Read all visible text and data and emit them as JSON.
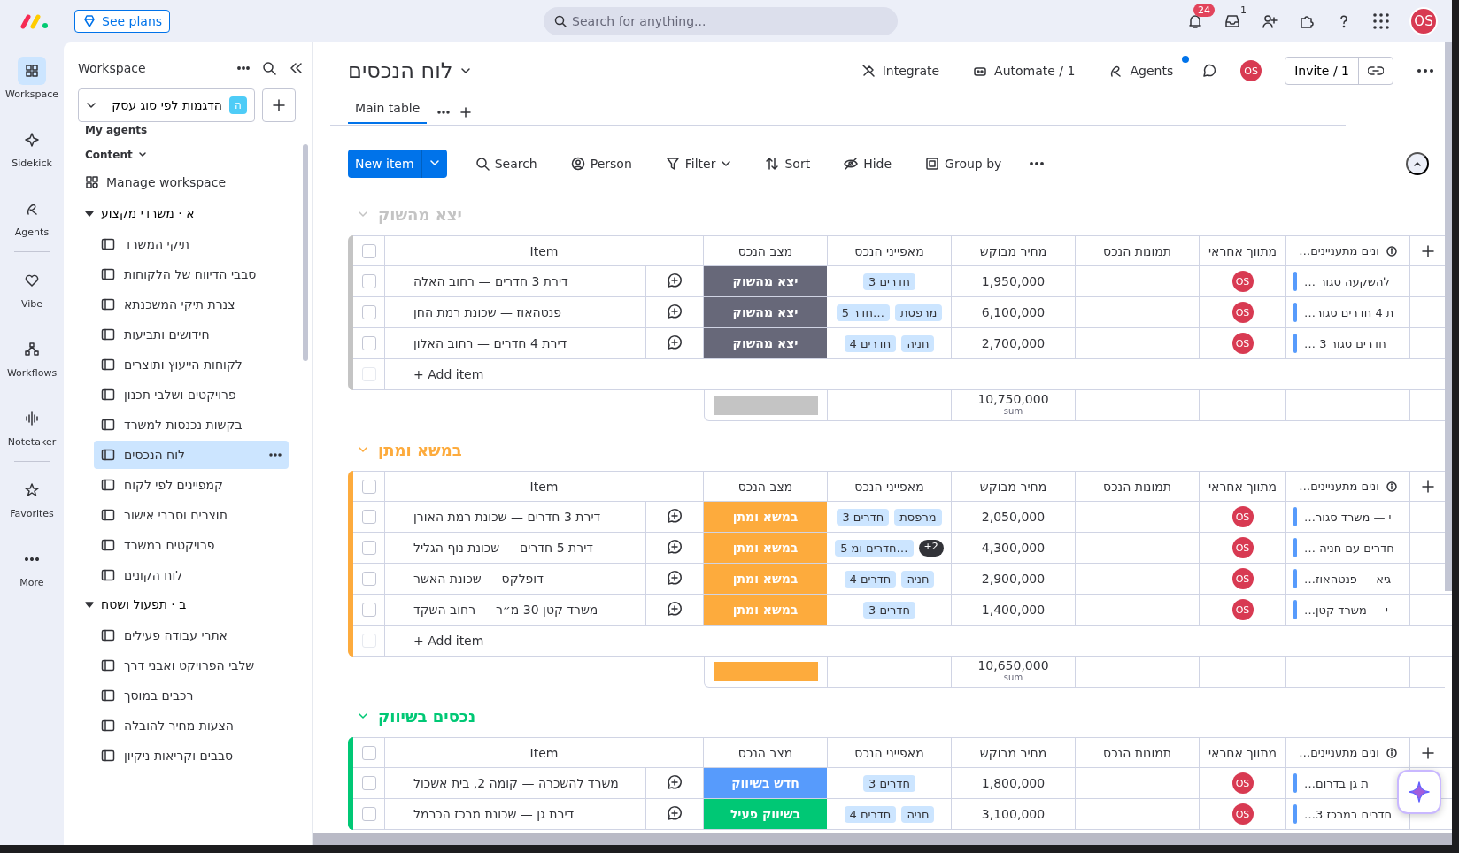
{
  "topbar": {
    "plans_button": "See plans",
    "search": {
      "placeholder": "Search for anything..."
    },
    "notifications_badge": "24",
    "inbox_count": "1",
    "avatar": "OS"
  },
  "rail": [
    {
      "label": "Workspace",
      "selected": true
    },
    {
      "label": "Sidekick",
      "selected": false
    },
    {
      "label": "Agents",
      "selected": false
    },
    {
      "label": "Vibe",
      "selected": false
    },
    {
      "label": "Workflows",
      "selected": false
    },
    {
      "label": "Notetaker",
      "selected": false
    },
    {
      "label": "Favorites",
      "selected": false
    },
    {
      "label": "More",
      "selected": false
    }
  ],
  "sidebar": {
    "title": "Workspace",
    "workspace": {
      "badge": "ה",
      "name": "הדגמות לפי סוג עסק"
    },
    "my_agents": "My agents",
    "content": "Content",
    "manage": "Manage workspace",
    "folders": [
      {
        "label": "א · משרדי מקצוע",
        "expanded": true,
        "children": [
          {
            "label": "תיקי המשרד",
            "selected": false
          },
          {
            "label": "סבבי הדיווח של הלקוחות",
            "selected": false
          },
          {
            "label": "צנרת תיקי המשכנתא",
            "selected": false
          },
          {
            "label": "חידושים ותביעות",
            "selected": false
          },
          {
            "label": "לקוחות הייעוץ ותוצרים",
            "selected": false
          },
          {
            "label": "פרויקטים ושלבי תכנון",
            "selected": false
          },
          {
            "label": "בקשות נכנסות למשרד",
            "selected": false
          },
          {
            "label": "לוח הנכסים",
            "selected": true
          },
          {
            "label": "קמפיינים לפי לקוח",
            "selected": false
          },
          {
            "label": "תוצרים וסבבי אישור",
            "selected": false
          },
          {
            "label": "פרויקטים במשרד",
            "selected": false
          },
          {
            "label": "לוח הקונים",
            "selected": false
          }
        ]
      },
      {
        "label": "ב · תפעול ושטח",
        "expanded": true,
        "children": [
          {
            "label": "אתרי עבודה פעילים",
            "selected": false
          },
          {
            "label": "שלבי הפרויקט ואבני דרך",
            "selected": false
          },
          {
            "label": "רכבים במוסך",
            "selected": false
          },
          {
            "label": "הצעות מחיר להובלה",
            "selected": false
          },
          {
            "label": "סבבים וקריאות ניקיון",
            "selected": false
          }
        ]
      }
    ]
  },
  "board": {
    "title": "לוח הנכסים",
    "actions": [
      "Agents",
      "Automate / 1",
      "Integrate"
    ],
    "avatar": "OS",
    "invite": "Invite / 1",
    "tabs": [
      {
        "label": "Main table",
        "selected": true
      }
    ],
    "toolbar": {
      "new_item": "New item",
      "items": [
        "Group by",
        "Hide",
        "Sort",
        "Filter",
        "Person",
        "Search"
      ]
    },
    "groups": [
      {
        "title": "יצא מהשוק",
        "color": "#c4c4c4",
        "expanded": true,
        "select_all_checked": false,
        "columns": [
          "…ונים מתעניינים",
          "מתווך אחראי",
          "תמונות הנכס",
          "מחיר מבוקש",
          "מאפייני הנכס",
          "מצב הנכס",
          "Item"
        ],
        "add_item": {
          "label": "+ Add item",
          "checked": false
        },
        "summary": {
          "sum": "10,750,000",
          "label": "sum"
        },
        "rows": [
          {
            "checked": false,
            "item": "דירת 3 חדרים — רחוב האלה",
            "status": {
              "label": "יצא מהשוק",
              "color": "#676879"
            },
            "tags": [
              "3 חדרים"
            ],
            "price": "1,950,000",
            "person": "OS",
            "interest": "… להשקעה סגור"
          },
          {
            "checked": false,
            "item": "פנטהאוז — שכונת רמת החן",
            "status": {
              "label": "יצא מהשוק",
              "color": "#676879"
            },
            "tags": [
              "מרפסת",
              "5 חדר…"
            ],
            "price": "6,100,000",
            "person": "OS",
            "interest": "…ת 4 חדרים סגור"
          },
          {
            "checked": false,
            "item": "דירת 4 חדרים — רחוב האלון",
            "status": {
              "label": "יצא מהשוק",
              "color": "#676879"
            },
            "tags": [
              "חניה",
              "4 חדרים"
            ],
            "price": "2,700,000",
            "person": "OS",
            "interest": "… 3 חדרים סגור"
          }
        ]
      },
      {
        "title": "במשא ומתן",
        "color": "#fdab3d",
        "expanded": true,
        "select_all_checked": false,
        "columns": [
          "…ונים מתעניינים",
          "מתווך אחראי",
          "תמונות הנכס",
          "מחיר מבוקש",
          "מאפייני הנכס",
          "מצב הנכס",
          "Item"
        ],
        "add_item": {
          "label": "+ Add item",
          "checked": false
        },
        "summary": {
          "sum": "10,650,000",
          "label": "sum"
        },
        "rows": [
          {
            "checked": false,
            "item": "דירת 3 חדרים — שכונת רמת האורן",
            "status": {
              "label": "במשא ומתן",
              "color": "#fdab3d"
            },
            "tags": [
              "מרפסת",
              "3 חדרים"
            ],
            "price": "2,050,000",
            "person": "OS",
            "interest": "…י — משרד סגור"
          },
          {
            "checked": false,
            "item": "דירת 5 חדרים — שכונת נוף הגליל",
            "status": {
              "label": "במשא ומתן",
              "color": "#fdab3d"
            },
            "more": "+2",
            "tags": [
              "5 חדרים ומ…"
            ],
            "price": "4,300,000",
            "person": "OS",
            "interest": "… חדרים עם חניה"
          },
          {
            "checked": false,
            "item": "דופלקס — שכונת האשר",
            "status": {
              "label": "במשא ומתן",
              "color": "#fdab3d"
            },
            "tags": [
              "חניה",
              "4 חדרים"
            ],
            "price": "2,900,000",
            "person": "OS",
            "interest": "…גיא — פנטהאוז"
          },
          {
            "checked": false,
            "item": "משרד קטן 30 מ״ר — רחוב השקד",
            "status": {
              "label": "במשא ומתן",
              "color": "#fdab3d"
            },
            "tags": [
              "3 חדרים"
            ],
            "price": "1,400,000",
            "person": "OS",
            "interest": "…י — משרד קטן"
          }
        ]
      },
      {
        "title": "נכסים בשיווק",
        "color": "#00c875",
        "expanded": true,
        "select_all_checked": false,
        "columns": [
          "…ונים מתעניינים",
          "מתווך אחראי",
          "תמונות הנכס",
          "מחיר מבוקש",
          "מאפייני הנכס",
          "מצב הנכס",
          "Item"
        ],
        "rows": [
          {
            "checked": false,
            "item": "משרד להשכרה — קומה 2, בית אשכול",
            "status": {
              "label": "חדש בשיווק",
              "color": "#579bfc"
            },
            "tags": [
              "3 חדרים"
            ],
            "price": "1,800,000",
            "person": "OS",
            "interest": "…ת גן בדרום"
          },
          {
            "checked": false,
            "item": "דירת גן — שכונת מרכז הכרמל",
            "status": {
              "label": "בשיווק פעיל",
              "color": "#00c875"
            },
            "tags": [
              "חניה",
              "4 חדרים"
            ],
            "price": "3,100,000",
            "person": "OS",
            "interest": "…3 חדרים במרכז"
          }
        ]
      }
    ]
  }
}
